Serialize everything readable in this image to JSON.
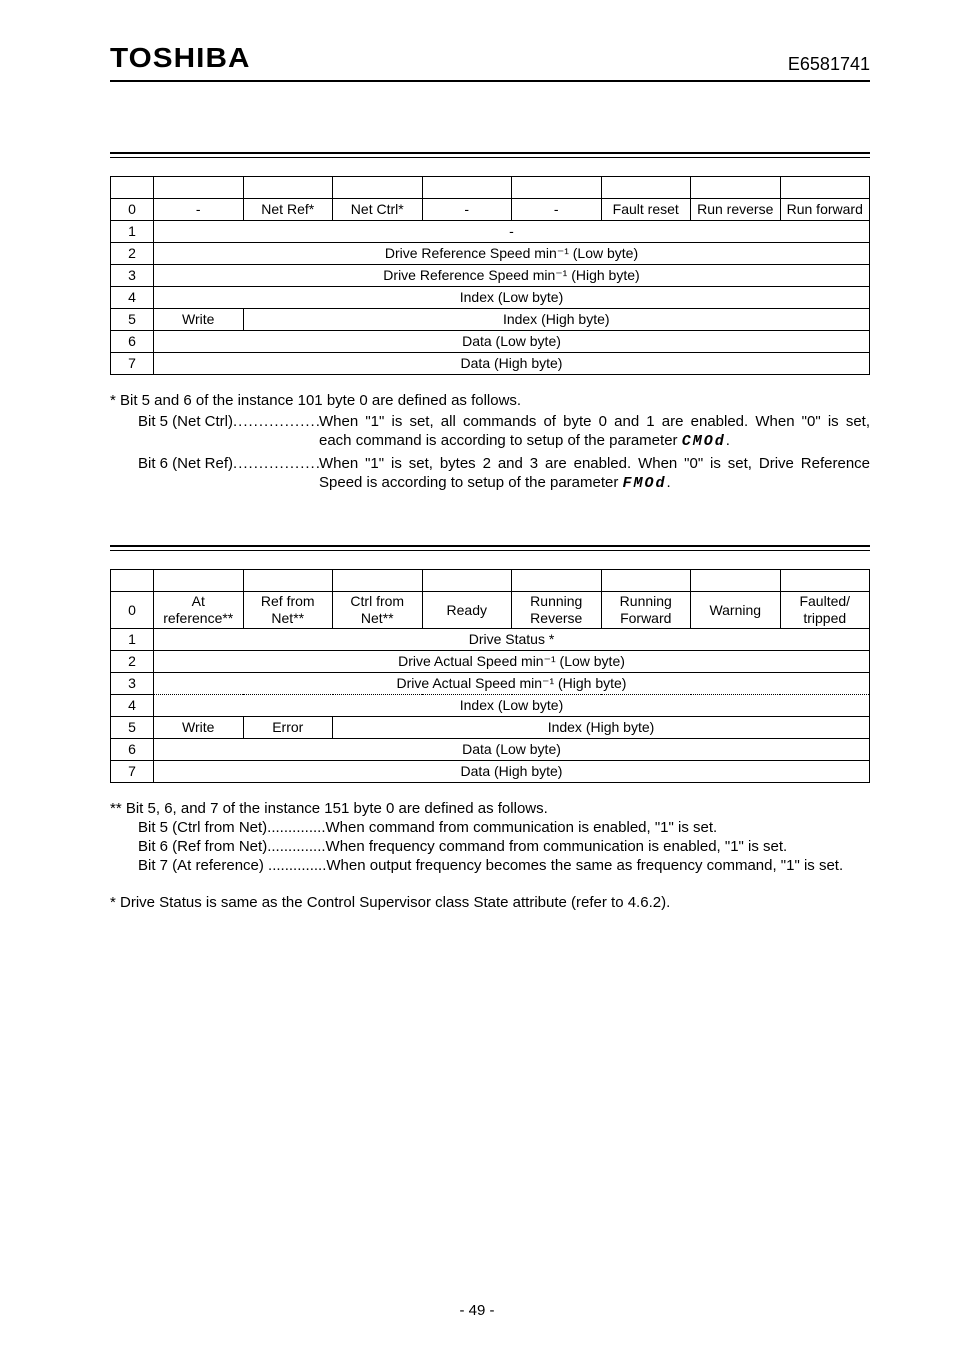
{
  "header": {
    "logo": "TOSHIBA",
    "docid": "E6581741"
  },
  "table1": {
    "row0": {
      "byte": "0",
      "cells": [
        "-",
        "Net Ref*",
        "Net Ctrl*",
        "-",
        "-",
        "Fault reset",
        "Run reverse",
        "Run forward"
      ]
    },
    "rows": [
      {
        "byte": "1",
        "text": "-"
      },
      {
        "byte": "2",
        "text": "Drive Reference Speed min⁻¹ (Low byte)"
      },
      {
        "byte": "3",
        "text": "Drive Reference Speed min⁻¹ (High byte)"
      },
      {
        "byte": "4",
        "text": "Index (Low byte)"
      },
      {
        "byte": "5",
        "left": "Write",
        "text": "Index (High byte)"
      },
      {
        "byte": "6",
        "text": "Data (Low byte)"
      },
      {
        "byte": "7",
        "text": "Data (High byte)"
      }
    ]
  },
  "notes1": {
    "intro": "* Bit 5 and 6 of the instance 101 byte 0 are defined as follows.",
    "bit5_label": "Bit 5 (Net Ctrl)",
    "bit5_line1": "When \"1\" is set, all commands of byte 0 and 1 are enabled. When \"0\" is set,",
    "bit5_line2_a": "each command is according to setup of the parameter ",
    "bit5_line2_b": ".",
    "bit5_param": "CMOd",
    "bit6_label": "Bit 6 (Net Ref)",
    "bit6_line1": "When \"1\" is set, bytes 2 and 3 are enabled. When \"0\" is set, Drive Reference",
    "bit6_line2_a": "Speed is according to setup of the parameter ",
    "bit6_line2_b": ".",
    "bit6_param": "FMOd"
  },
  "table2": {
    "row0": {
      "byte": "0",
      "cells": [
        "At reference**",
        "Ref from Net**",
        "Ctrl from Net**",
        "Ready",
        "Running Reverse",
        "Running Forward",
        "Warning",
        "Faulted/ tripped"
      ]
    },
    "rows": [
      {
        "byte": "1",
        "text": "Drive Status *"
      },
      {
        "byte": "2",
        "text": "Drive Actual Speed min⁻¹ (Low byte)"
      },
      {
        "byte": "3",
        "text": "Drive Actual Speed min⁻¹ (High byte)"
      },
      {
        "byte": "4",
        "text": "Index (Low byte)"
      },
      {
        "byte": "5",
        "left1": "Write",
        "left2": "Error",
        "text": "Index (High byte)"
      },
      {
        "byte": "6",
        "text": "Data (Low byte)"
      },
      {
        "byte": "7",
        "text": "Data (High byte)"
      }
    ]
  },
  "notes2": {
    "intro": "** Bit 5, 6, and 7 of the instance 151 byte 0 are defined as follows.",
    "l1": "Bit 5 (Ctrl from Net)..............When command from communication is enabled, \"1\" is set.",
    "l2": "Bit 6 (Ref from Net)..............When frequency command from communication is enabled, \"1\" is set.",
    "l3": "Bit 7 (At reference) ..............When output frequency becomes the same as frequency command, \"1\" is set.",
    "final": "* Drive Status is same as the Control Supervisor class State attribute (refer to 4.6.2)."
  },
  "footer": {
    "page": "- 49 -"
  }
}
